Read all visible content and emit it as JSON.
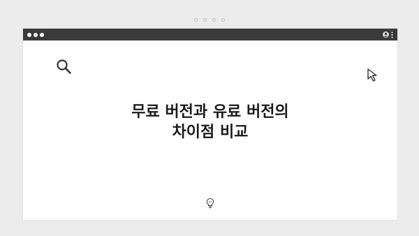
{
  "pager": {
    "count": 4
  },
  "window": {
    "headline": {
      "line1": "무료 버전과 유료 버전의",
      "line2": "차이점 비교"
    }
  },
  "icons": {
    "search": "search-icon",
    "cursor": "cursor-arrow-icon",
    "bulb": "lightbulb-icon",
    "user": "user-icon",
    "menu": "kebab-menu-icon"
  },
  "colors": {
    "background": "#ececec",
    "titlebar": "#3a3a3a",
    "canvas": "#ffffff",
    "text": "#1a1a1a"
  }
}
